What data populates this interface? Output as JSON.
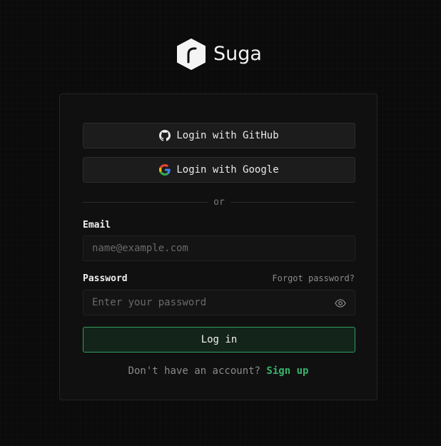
{
  "brand": {
    "name": "Suga",
    "logo_icon": "suga-logo-icon"
  },
  "oauth": {
    "github_label": "Login with GitHub",
    "github_icon": "github-icon",
    "google_label": "Login with Google",
    "google_icon": "google-icon"
  },
  "divider_text": "or",
  "email": {
    "label": "Email",
    "placeholder": "name@example.com",
    "value": ""
  },
  "password": {
    "label": "Password",
    "forgot_label": "Forgot password?",
    "placeholder": "Enter your password",
    "value": "",
    "toggle_icon": "eye-icon"
  },
  "login_label": "Log in",
  "signup": {
    "prompt": "Don't have an account?",
    "link_label": "Sign up"
  },
  "colors": {
    "background": "#0b0b0b",
    "card": "#101010",
    "accent": "#36b36a",
    "login_border": "#2f9e5d"
  }
}
